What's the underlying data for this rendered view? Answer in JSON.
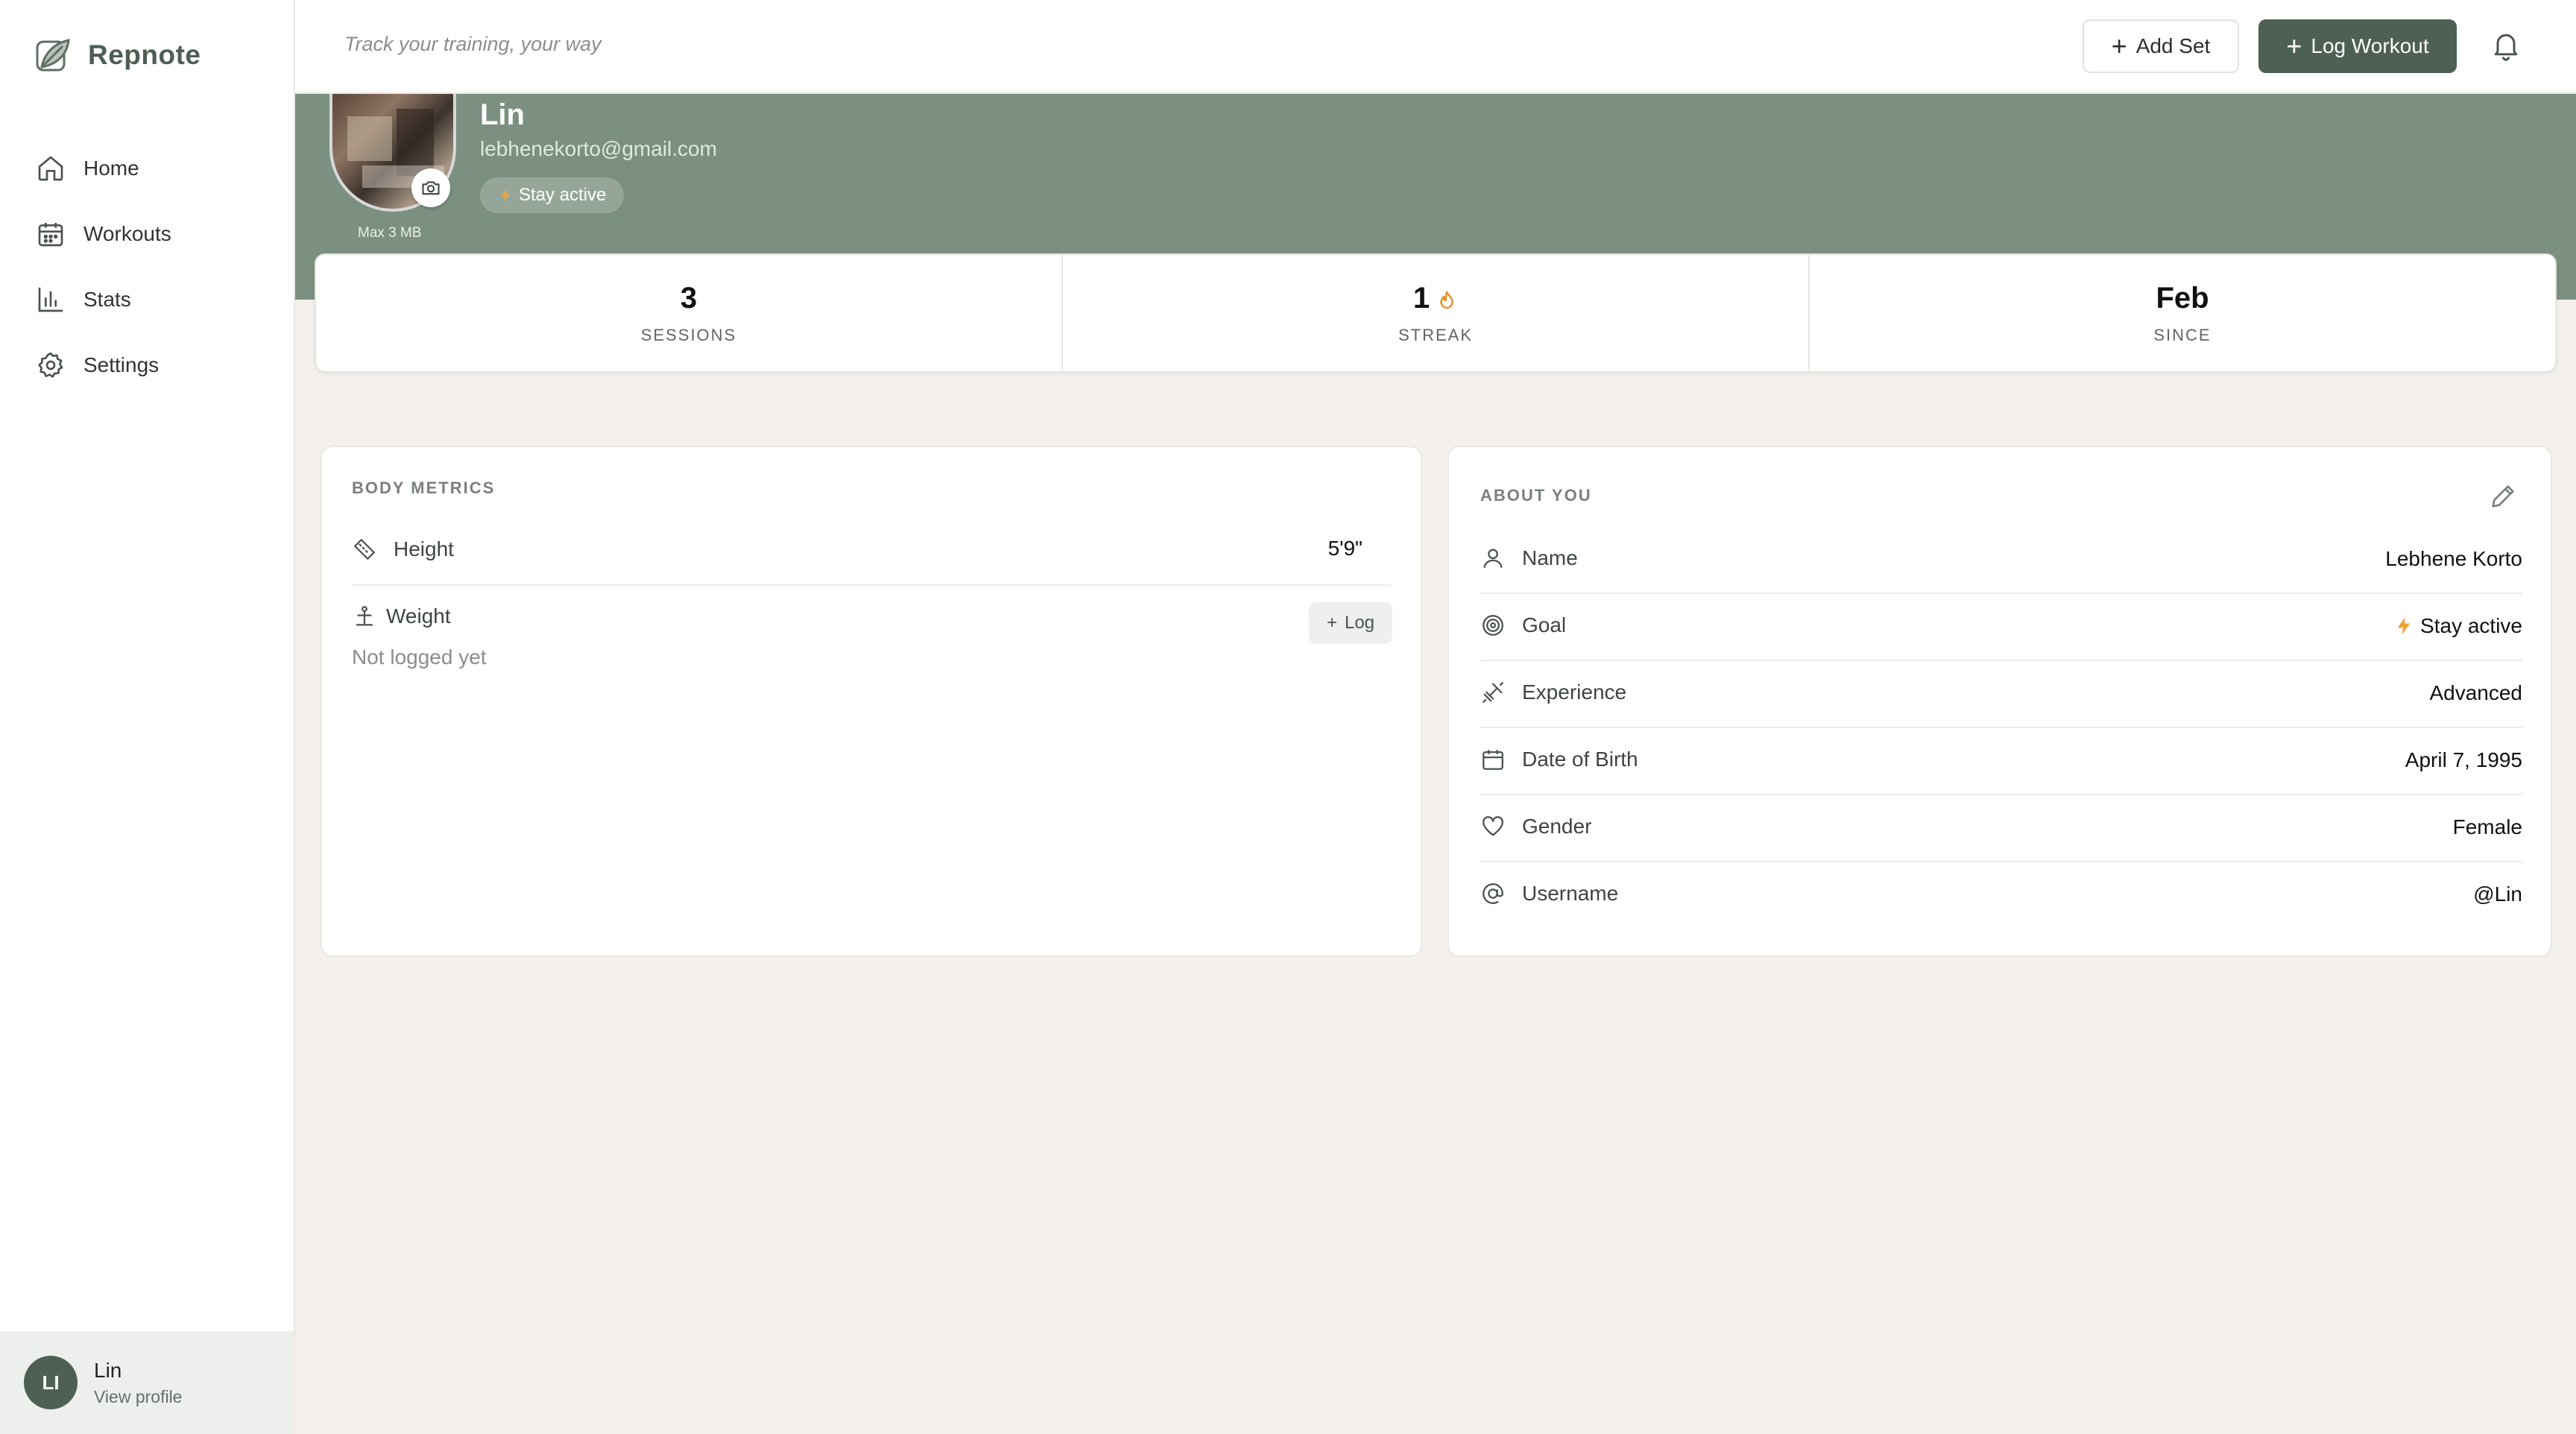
{
  "app": {
    "name": "Repnote"
  },
  "sidebar": {
    "items": [
      {
        "label": "Home",
        "icon": "home-icon"
      },
      {
        "label": "Workouts",
        "icon": "calendar-icon"
      },
      {
        "label": "Stats",
        "icon": "bar-chart-icon"
      },
      {
        "label": "Settings",
        "icon": "gear-icon"
      }
    ],
    "user": {
      "initials": "LI",
      "name": "Lin",
      "link": "View profile"
    }
  },
  "topbar": {
    "tagline": "Track your training, your way",
    "add_set_label": "Add Set",
    "log_workout_label": "Log Workout"
  },
  "profile": {
    "name": "Lin",
    "email": "lebhenekorto@gmail.com",
    "goal_badge": "Stay active",
    "upload_hint": "Max 3 MB"
  },
  "stats": [
    {
      "value": "3",
      "label": "SESSIONS"
    },
    {
      "value": "1",
      "label": "STREAK"
    },
    {
      "value": "Feb",
      "label": "SINCE"
    }
  ],
  "body_metrics": {
    "title": "BODY METRICS",
    "height_label": "Height",
    "height_value": "5'9\"",
    "weight_label": "Weight",
    "weight_empty": "Not logged yet",
    "log_label": "Log"
  },
  "about": {
    "title": "ABOUT YOU",
    "rows": [
      {
        "label": "Name",
        "value": "Lebhene Korto"
      },
      {
        "label": "Goal",
        "value": "Stay active"
      },
      {
        "label": "Experience",
        "value": "Advanced"
      },
      {
        "label": "Date of Birth",
        "value": "April 7, 1995"
      },
      {
        "label": "Gender",
        "value": "Female"
      },
      {
        "label": "Username",
        "value": "@Lin"
      }
    ]
  },
  "colors": {
    "accent": "#4e5f53",
    "banner": "#7b9080",
    "background": "#f4f0eb",
    "flame": "#e8912c"
  }
}
